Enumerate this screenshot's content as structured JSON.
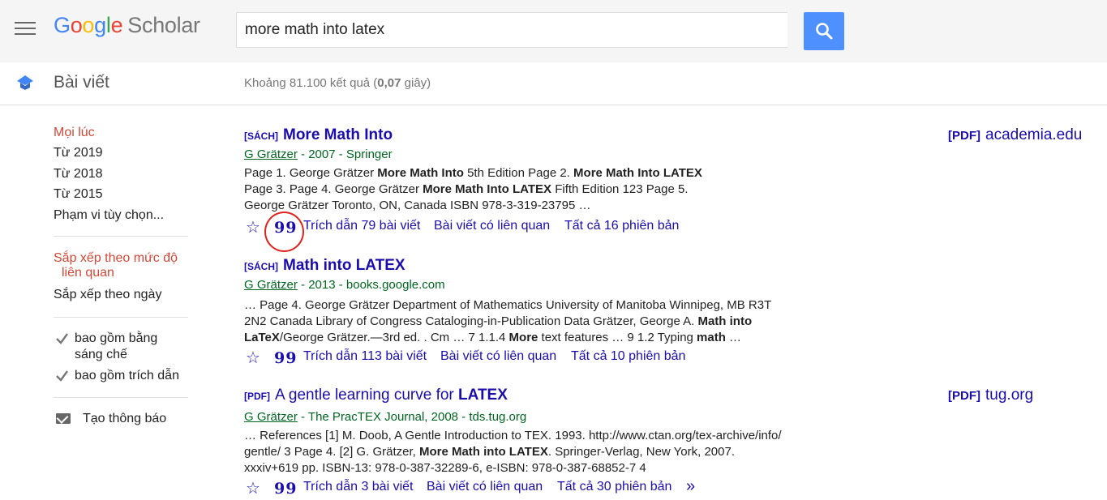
{
  "header": {
    "logo_google": "Google",
    "logo_scholar": "Scholar",
    "search_value": "more math into latex"
  },
  "subbar": {
    "section": "Bài viết",
    "stats_prefix": "Khoảng 81.100 kết quả (",
    "stats_time": "0,07",
    "stats_suffix": " giây)"
  },
  "sidebar": {
    "time_any": "Mọi lúc",
    "time_2019": "Từ 2019",
    "time_2018": "Từ 2018",
    "time_2015": "Từ 2015",
    "time_custom": "Phạm vi tùy chọn...",
    "sort_relevance_1": "Sắp xếp theo mức độ",
    "sort_relevance_2": "liên quan",
    "sort_date": "Sắp xếp theo ngày",
    "include_patents_1": "bao gồm bằng",
    "include_patents_2": "sáng chế",
    "include_citations": "bao gồm trích dẫn",
    "create_alert": "Tạo thông báo"
  },
  "results": [
    {
      "tag": "[SÁCH]",
      "title": "More Math Into",
      "author": "G Grätzer",
      "meta": " - 2007 - Springer",
      "snippet_html": "Page 1. George Grätzer <b>More Math Into</b> 5th Edition Page 2. <b>More Math Into LATEX</b><br>Page 3. Page 4. George Grätzer <b>More Math Into LATEX</b> Fifth Edition 123 Page 5.<br>George Grätzer Toronto, ON, Canada ISBN 978-3-319-23795 …",
      "cited": "Trích dẫn 79 bài viết",
      "related": "Bài viết có liên quan",
      "versions": "Tất cả 16 phiên bản",
      "side_tag": "[PDF]",
      "side_site": "academia.edu"
    },
    {
      "tag": "[SÁCH]",
      "title": "Math into LATEX",
      "author": "G Grätzer",
      "meta": " - 2013 - books.google.com",
      "snippet_html": "… Page 4. George Grätzer Department of Mathematics University of Manitoba Winnipeg, MB R3T<br>2N2 Canada Library of Congress Cataloging-in-Publication Data Grätzer, George A. <b>Math into</b><br><b>LaTeX</b>/George Grätzer.—3rd ed. . Cm … 7 1.1.4 <b>More</b> text features … 9 1.2 Typing <b>math</b> …",
      "cited": "Trích dẫn 113 bài viết",
      "related": "Bài viết có liên quan",
      "versions": "Tất cả 10 phiên bản"
    },
    {
      "tag": "[PDF]",
      "title_plain": "A gentle learning curve for ",
      "title_bold": "LATEX",
      "author": "G Grätzer",
      "meta": " - The PracTEX Journal, 2008 - tds.tug.org",
      "snippet_html": "… References [1] M. Doob, A Gentle Introduction to TEX. 1993. http://www.ctan.org/tex-archive/info/<br>gentle/ 3 Page 4. [2] G. Grätzer, <b>More Math into LATEX</b>. Springer-Verlag, New York, 2007.<br>xxxiv+619 pp. ISBN-13: 978-0-387-32289-6, e-ISBN: 978-0-387-68852-7 4",
      "cited": "Trích dẫn 3 bài viết",
      "related": "Bài viết có liên quan",
      "versions": "Tất cả 30 phiên bản",
      "side_tag": "[PDF]",
      "side_site": "tug.org"
    }
  ],
  "icons": {
    "star": "☆",
    "quote": "99",
    "more": "»"
  },
  "colors": {
    "link": "#1a0dab",
    "green": "#006621",
    "accent_red": "#d14836",
    "search_blue": "#4d90fe",
    "annotation_red": "#e0231c"
  }
}
